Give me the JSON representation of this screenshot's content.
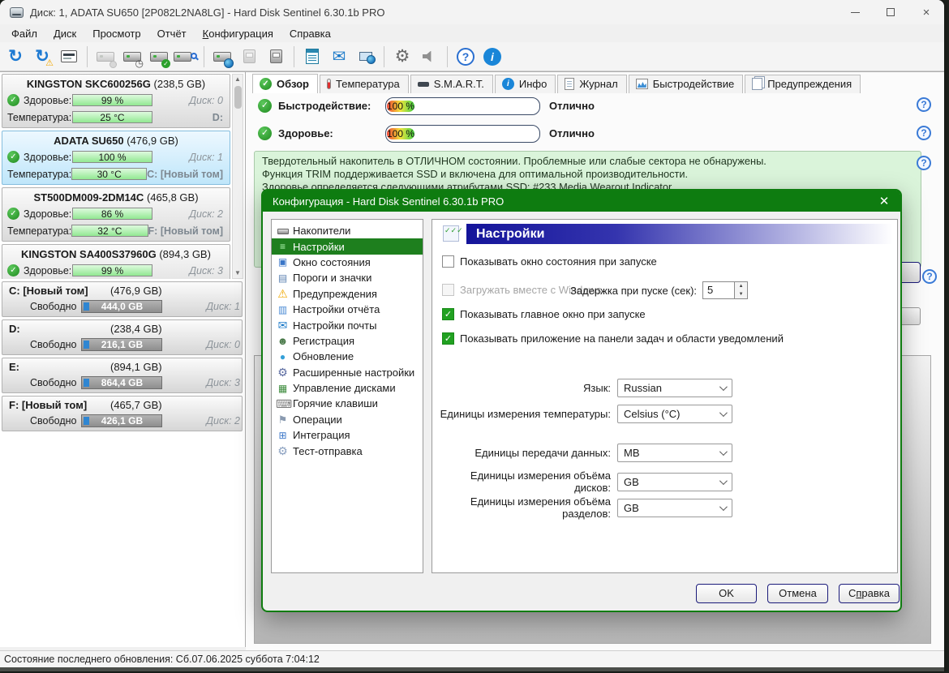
{
  "window": {
    "title": "Диск: 1, ADATA SU650 [2P082L2NA8LG]  -  Hard Disk Sentinel 6.30.1b PRO"
  },
  "menu": {
    "items": [
      {
        "a": "",
        "t": "Файл"
      },
      {
        "a": "",
        "t": "Диск"
      },
      {
        "a": "",
        "t": "Просмотр"
      },
      {
        "a": "",
        "t": "Отчёт"
      },
      {
        "a": "К",
        "t": "онфигурация"
      },
      {
        "a": "",
        "t": "Справка"
      }
    ]
  },
  "toolbar": {
    "icons": [
      "refresh",
      "refresh-warning",
      "disk-status-window",
      "disk-mouse",
      "disk-clock",
      "disk-test",
      "disk-search",
      "disk-online",
      "disk-tray",
      "disk-eject",
      "report",
      "mail",
      "network-update",
      "settings",
      "sounds",
      "help",
      "information"
    ]
  },
  "sidebar": {
    "health_label": "Здоровье:",
    "temp_label": "Температура:",
    "free_label": "Свободно",
    "disks": [
      {
        "name": "KINGSTON SKC600256G",
        "size": "(238,5 GB)",
        "health": "99 %",
        "disk": "Диск: 0",
        "temp": "25 °C",
        "drive": "D:"
      },
      {
        "name": "ADATA SU650",
        "size": "(476,9 GB)",
        "health": "100 %",
        "disk": "Диск: 1",
        "temp": "30 °C",
        "drive": "C: [Новый том]"
      },
      {
        "name": "ST500DM009-2DM14C",
        "size": "(465,8 GB)",
        "health": "86 %",
        "disk": "Диск: 2",
        "temp": "32 °C",
        "drive": "F: [Новый том]"
      },
      {
        "name": "KINGSTON SA400S37960G",
        "size": "(894,3 GB)",
        "health": "99 %",
        "disk": "Диск: 3",
        "temp": "",
        "drive": ""
      }
    ],
    "partitions": [
      {
        "name": "C: [Новый том]",
        "size": "(476,9 GB)",
        "free": "444,0 GB",
        "disk": "Диск: 1"
      },
      {
        "name": "D:",
        "size": "(238,4 GB)",
        "free": "216,1 GB",
        "disk": "Диск: 0"
      },
      {
        "name": "E:",
        "size": "(894,1 GB)",
        "free": "864,4 GB",
        "disk": "Диск: 3"
      },
      {
        "name": "F: [Новый том]",
        "size": "(465,7 GB)",
        "free": "426,1 GB",
        "disk": "Диск: 2"
      }
    ]
  },
  "tabs": [
    {
      "label": "Обзор"
    },
    {
      "label": "Температура"
    },
    {
      "label": "S.M.A.R.T."
    },
    {
      "label": "Инфо"
    },
    {
      "label": "Журнал"
    },
    {
      "label": "Быстродействие"
    },
    {
      "label": "Предупреждения"
    }
  ],
  "overview": {
    "rows": [
      {
        "label": "Быстродействие:",
        "value": "100 %",
        "status": "Отлично"
      },
      {
        "label": "Здоровье:",
        "value": "100 %",
        "status": "Отлично"
      }
    ],
    "info_lines": [
      "Твердотельный накопитель в ОТЛИЧНОМ состоянии. Проблемные или слабые сектора не обнаружены.",
      "Функция TRIM поддерживается SSD и включена для оптимальной производительности.",
      "Здоровье определяется следующими атрибутами SSD: #233 Media Wearout Indicator"
    ]
  },
  "dialog": {
    "title": "Конфигурация  -  Hard Disk Sentinel 6.30.1b PRO",
    "nav": [
      "Накопители",
      "Настройки",
      "Окно состояния",
      "Пороги и значки",
      "Предупреждения",
      "Настройки отчёта",
      "Настройки почты",
      "Регистрация",
      "Обновление",
      "Расширенные настройки",
      "Управление дисками",
      "Горячие клавиши",
      "Операции",
      "Интеграция",
      "Тест-отправка"
    ],
    "panel": {
      "header": "Настройки",
      "checkboxes": [
        {
          "label": "Показывать окно состояния при запуске"
        },
        {
          "label": "Загружать вместе с Windows"
        },
        {
          "label": "Показывать главное окно при запуске"
        },
        {
          "label": "Показывать приложение на панели задач и области уведомлений"
        }
      ],
      "spinner": {
        "label": "Задержка при пуске (сек):",
        "value": "5"
      },
      "selects": [
        {
          "label": "Язык:",
          "value": "Russian"
        },
        {
          "label": "Единицы измерения температуры:",
          "value": "Celsius (°C)"
        },
        {
          "label": "Единицы передачи данных:",
          "value": "MB"
        },
        {
          "label": "Единицы измерения объёма дисков:",
          "value": "GB"
        },
        {
          "label": "Единицы измерения объёма разделов:",
          "value": "GB"
        }
      ]
    },
    "buttons": {
      "ok": "OK",
      "cancel": "Отмена",
      "help_pre": "С",
      "help_accel": "п",
      "help_rest": "равка"
    }
  },
  "statusbar": {
    "text": "Состояние последнего обновления: Сб.07.06.2025 суббота 7:04:12"
  },
  "colors": {
    "accent_green": "#0e7c10",
    "selection_blue": "#cbe8f6",
    "health_bar_green": "#92e892",
    "free_bar_blue": "#2f86d2",
    "banner_navy": "#14149a"
  }
}
